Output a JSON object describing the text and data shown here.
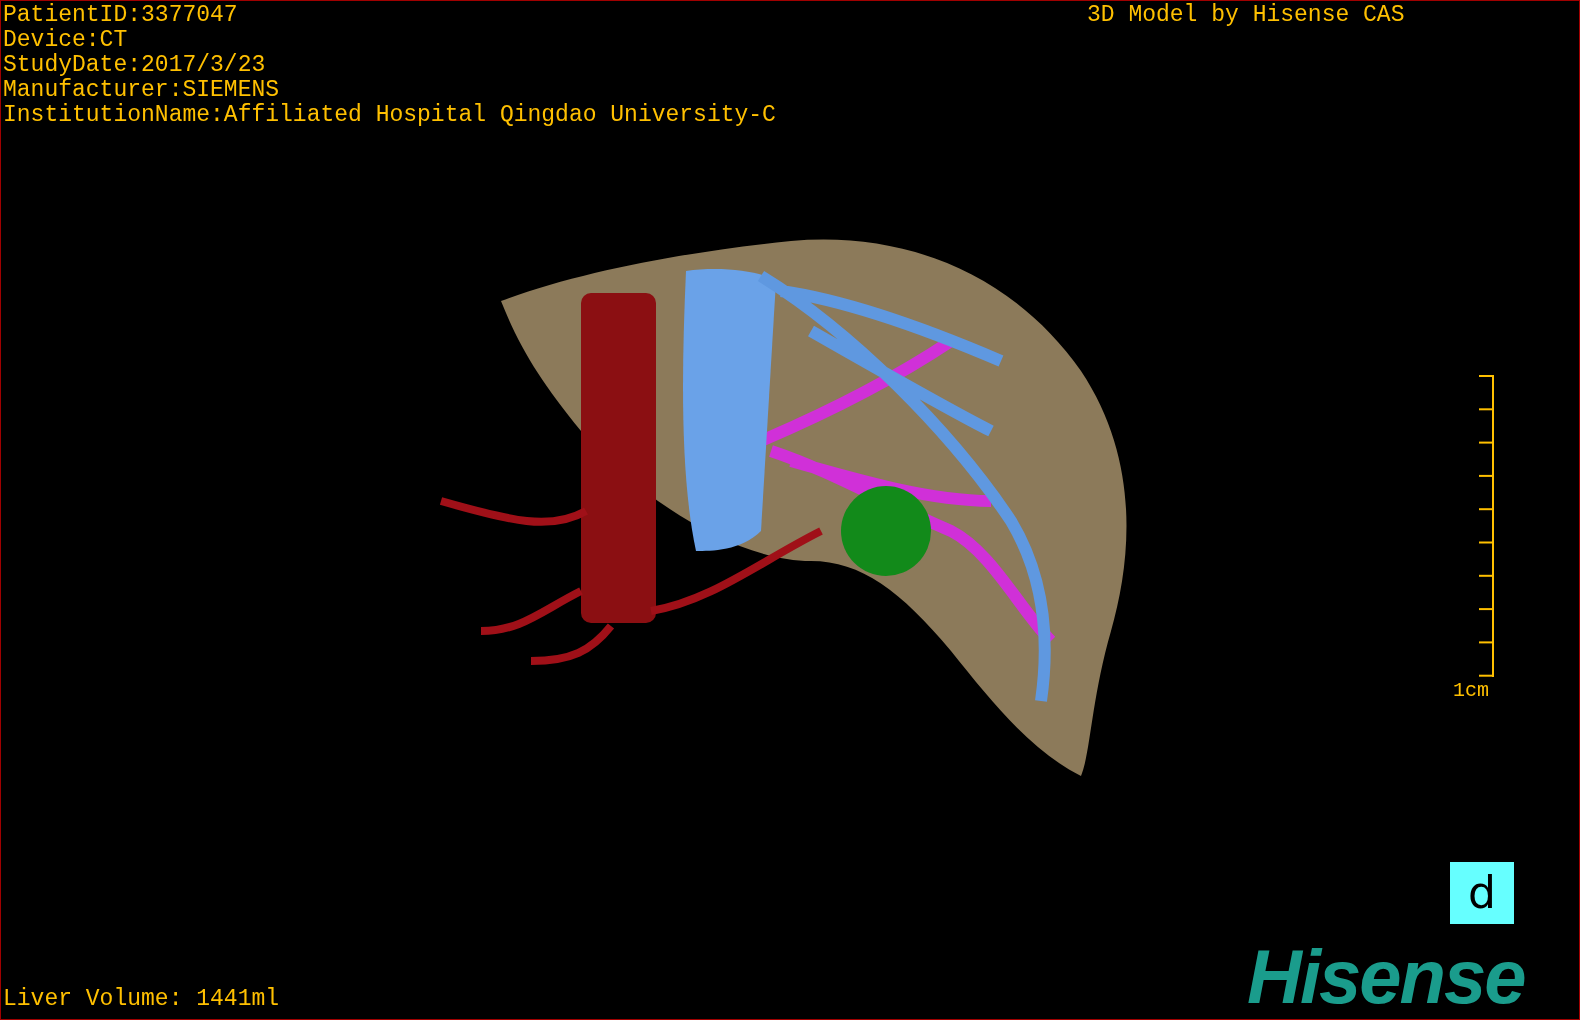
{
  "study_info": [
    "PatientID:3377047",
    "Device:CT",
    "StudyDate:2017/3/23",
    "Manufacturer:SIEMENS",
    "InstitutionName:Affiliated Hospital Qingdao University-C"
  ],
  "model_credit": "3D Model by Hisense CAS",
  "scale_bar": {
    "label": "1cm"
  },
  "orientation_marker": "d",
  "liver_volume": "Liver Volume: 1441ml",
  "logo": "Hisense"
}
